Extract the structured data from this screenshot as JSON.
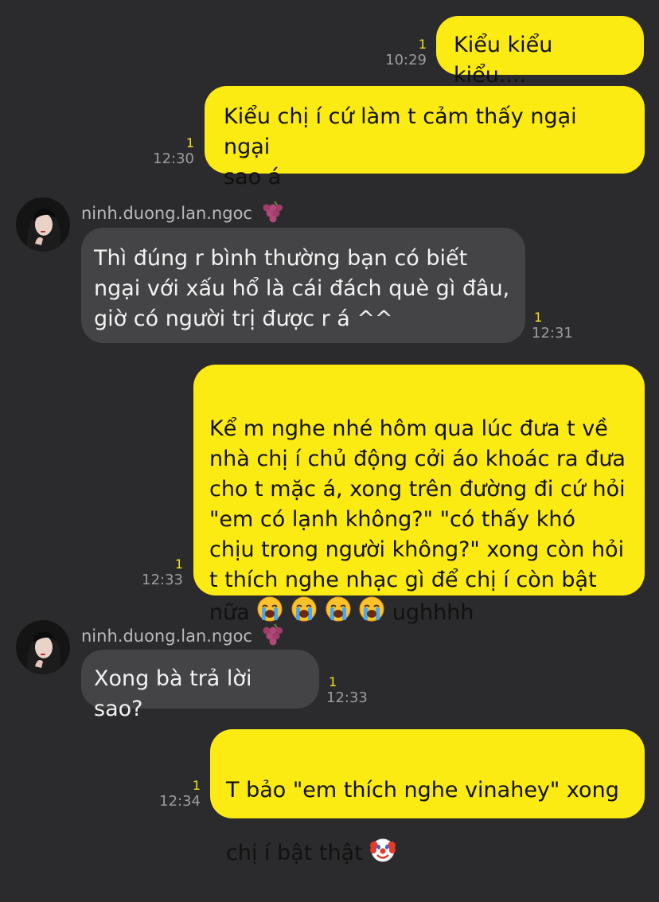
{
  "messages": [
    {
      "direction": "out",
      "text": "Kiểu kiểu kiểu....",
      "unread": "1",
      "time": "10:29"
    },
    {
      "direction": "out",
      "text": "Kiểu chị í cứ làm t cảm thấy ngại ngại\nsao á",
      "unread": "1",
      "time": "12:30"
    },
    {
      "direction": "in",
      "sender": "ninh.duong.lan.ngoc",
      "text": "Thì đúng r bình thường bạn có biết\nngại với xấu hổ là cái đách què gì đâu,\ngiờ có người trị được r á ^^",
      "unread": "1",
      "time": "12:31"
    },
    {
      "direction": "out",
      "text": "Kể m nghe nhé hôm qua lúc đưa t về\nnhà chị í chủ động cởi áo khoác ra đưa\ncho t mặc á, xong trên đường đi cứ hỏi\n\"em có lạnh không?\" \"có thấy khó\nchịu trong người không?\" xong còn hỏi\nt thích nghe nhạc gì để chị í còn bật",
      "last_line_text": "nữa",
      "emoji": "loudly-crying-face",
      "emoji_count": 4,
      "tail_text": "ughhhh",
      "unread": "1",
      "time": "12:33"
    },
    {
      "direction": "in",
      "sender": "ninh.duong.lan.ngoc",
      "text": "Xong bà trả lời sao?",
      "unread": "1",
      "time": "12:33"
    },
    {
      "direction": "out",
      "text": "T bảo \"em thích nghe vinahey\" xong",
      "second_line_text": "chị í bật thật",
      "emoji": "clown-face",
      "unread": "1",
      "time": "12:34"
    }
  ],
  "colors": {
    "background": "#2b2b2d",
    "outgoing_bubble": "#fcea13",
    "incoming_bubble": "#444446",
    "unread_count": "#f5e11a",
    "timestamp": "#9c9c9e"
  },
  "icons": {
    "sender_badge": "grape-icon",
    "avatar": "profile-photo"
  }
}
